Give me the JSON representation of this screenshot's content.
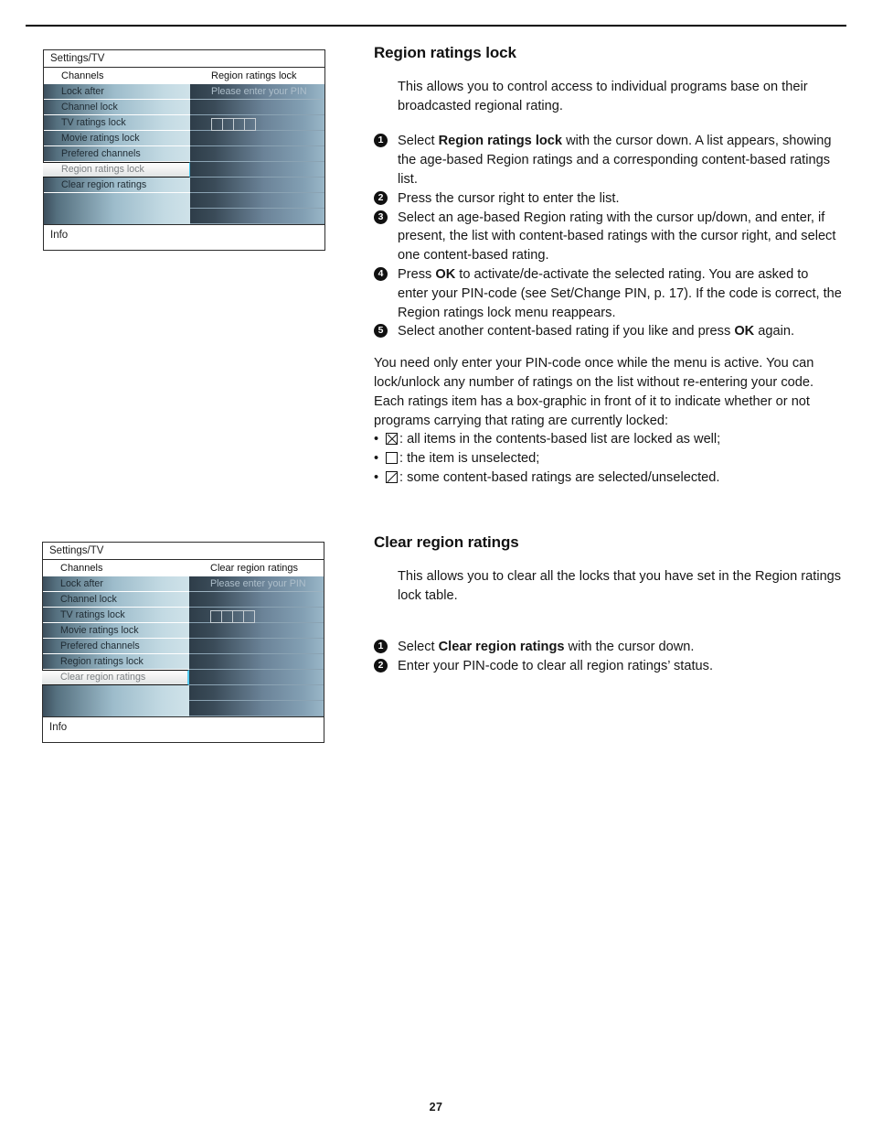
{
  "page": {
    "number": "27"
  },
  "tv_menu_1": {
    "title": "Settings/TV",
    "column_header_left": "Channels",
    "column_header_right": "Region ratings lock",
    "items": [
      "Lock after",
      "Channel lock",
      "TV ratings lock",
      "Movie ratings lock",
      "Prefered channels",
      "Region ratings lock",
      "Clear region ratings"
    ],
    "selected_item": "Region ratings lock",
    "pin_prompt": "Please enter your PIN",
    "pin_box_count": 4,
    "info_label": "Info"
  },
  "tv_menu_2": {
    "title": "Settings/TV",
    "column_header_left": "Channels",
    "column_header_right": "Clear region ratings",
    "items": [
      "Lock after",
      "Channel lock",
      "TV ratings lock",
      "Movie ratings lock",
      "Prefered channels",
      "Region ratings lock",
      "Clear region ratings"
    ],
    "selected_item": "Clear region ratings",
    "pin_prompt": "Please enter your PIN",
    "pin_box_count": 4,
    "info_label": "Info"
  },
  "section_region": {
    "heading": "Region ratings lock",
    "intro": "This allows you to control access to individual programs base on their broadcasted regional rating.",
    "steps": [
      {
        "num": "1",
        "pre": "Select ",
        "bold": "Region ratings lock",
        "post": " with the cursor down. A list appears, showing the age-based Region ratings and a corresponding content-based ratings list."
      },
      {
        "num": "2",
        "pre": "Press the cursor right to enter the list.",
        "bold": "",
        "post": ""
      },
      {
        "num": "3",
        "pre": "Select an age-based Region rating with the cursor up/down, and enter, if present, the list with content-based ratings with the cursor right, and select one content-based rating.",
        "bold": "",
        "post": ""
      },
      {
        "num": "4",
        "pre": "Press ",
        "bold": "OK",
        "post": " to activate/de-activate the selected rating. You are asked to enter your PIN-code (see Set/Change PIN, p. 17). If the code is correct, the Region ratings lock menu reappears."
      },
      {
        "num": "5",
        "pre": "Select another content-based rating if you like and press ",
        "bold": "OK",
        "post": " again."
      }
    ],
    "note_paragraph_1": "You need only enter your PIN-code once while the menu is active. You can lock/unlock any number of ratings on the list without re-entering your code.",
    "note_paragraph_2": "Each ratings item has a box-graphic in front of it to indicate whether or not programs carrying that rating are currently locked:",
    "box_legend": [
      {
        "glyph": "box-x",
        "text": ": all items in the contents-based list are locked as well;"
      },
      {
        "glyph": "box-empty",
        "text": ": the item is unselected;"
      },
      {
        "glyph": "box-slash",
        "text": ": some content-based ratings are selected/unselected."
      }
    ]
  },
  "section_clear": {
    "heading": "Clear region ratings",
    "intro": "This allows you to clear all the locks that you have set in the Region ratings lock table.",
    "steps": [
      {
        "num": "1",
        "pre": "Select ",
        "bold": "Clear region ratings",
        "post": " with the cursor down."
      },
      {
        "num": "2",
        "pre": "Enter your PIN-code to clear all region ratings’ status.",
        "bold": "",
        "post": ""
      }
    ]
  }
}
